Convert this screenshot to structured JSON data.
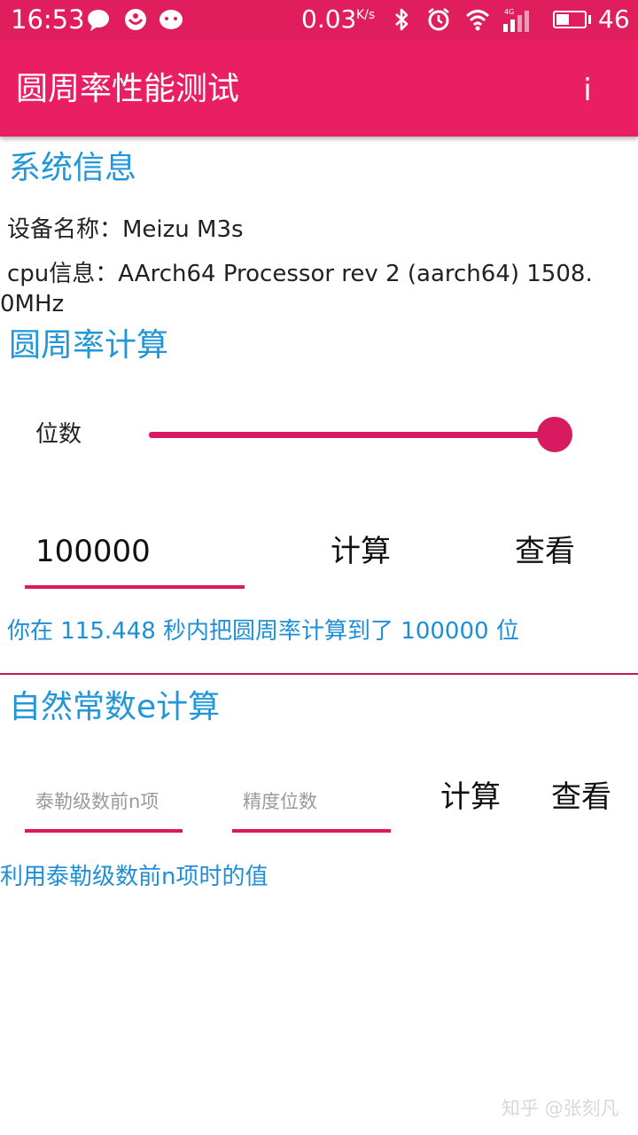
{
  "status_bar": {
    "time": "16:53",
    "net_speed": "0.03",
    "net_unit": "K/s",
    "battery_level": "46",
    "battery_fill": 0.46
  },
  "app_bar": {
    "title": "圆周率性能测试",
    "info_label": "i"
  },
  "system_info": {
    "title": "系统信息",
    "device": "设备名称：Meizu M3s",
    "cpu_line1": "cpu信息：AArch64 Processor rev 2 (aarch64)  1508.",
    "cpu_line2": "0MHz"
  },
  "pi_section": {
    "title": "圆周率计算",
    "slider_label": "位数",
    "slider_position": 1.0,
    "input_value": "100000",
    "calc_button": "计算",
    "view_button": "查看",
    "result": "你在 115.448 秒内把圆周率计算到了 100000 位"
  },
  "e_section": {
    "title": "自然常数e计算",
    "terms_placeholder": "泰勒级数前n项",
    "precision_placeholder": "精度位数",
    "calc_button": "计算",
    "view_button": "查看",
    "result": "利用泰勒级数前n项时的值"
  },
  "watermark": "知乎 @张刻凡",
  "colors": {
    "status_bar": "#e01e5e",
    "app_bar": "#e91e63",
    "accent": "#d81b60",
    "section_title": "#2196d9",
    "result_text": "#1e8fd6"
  }
}
